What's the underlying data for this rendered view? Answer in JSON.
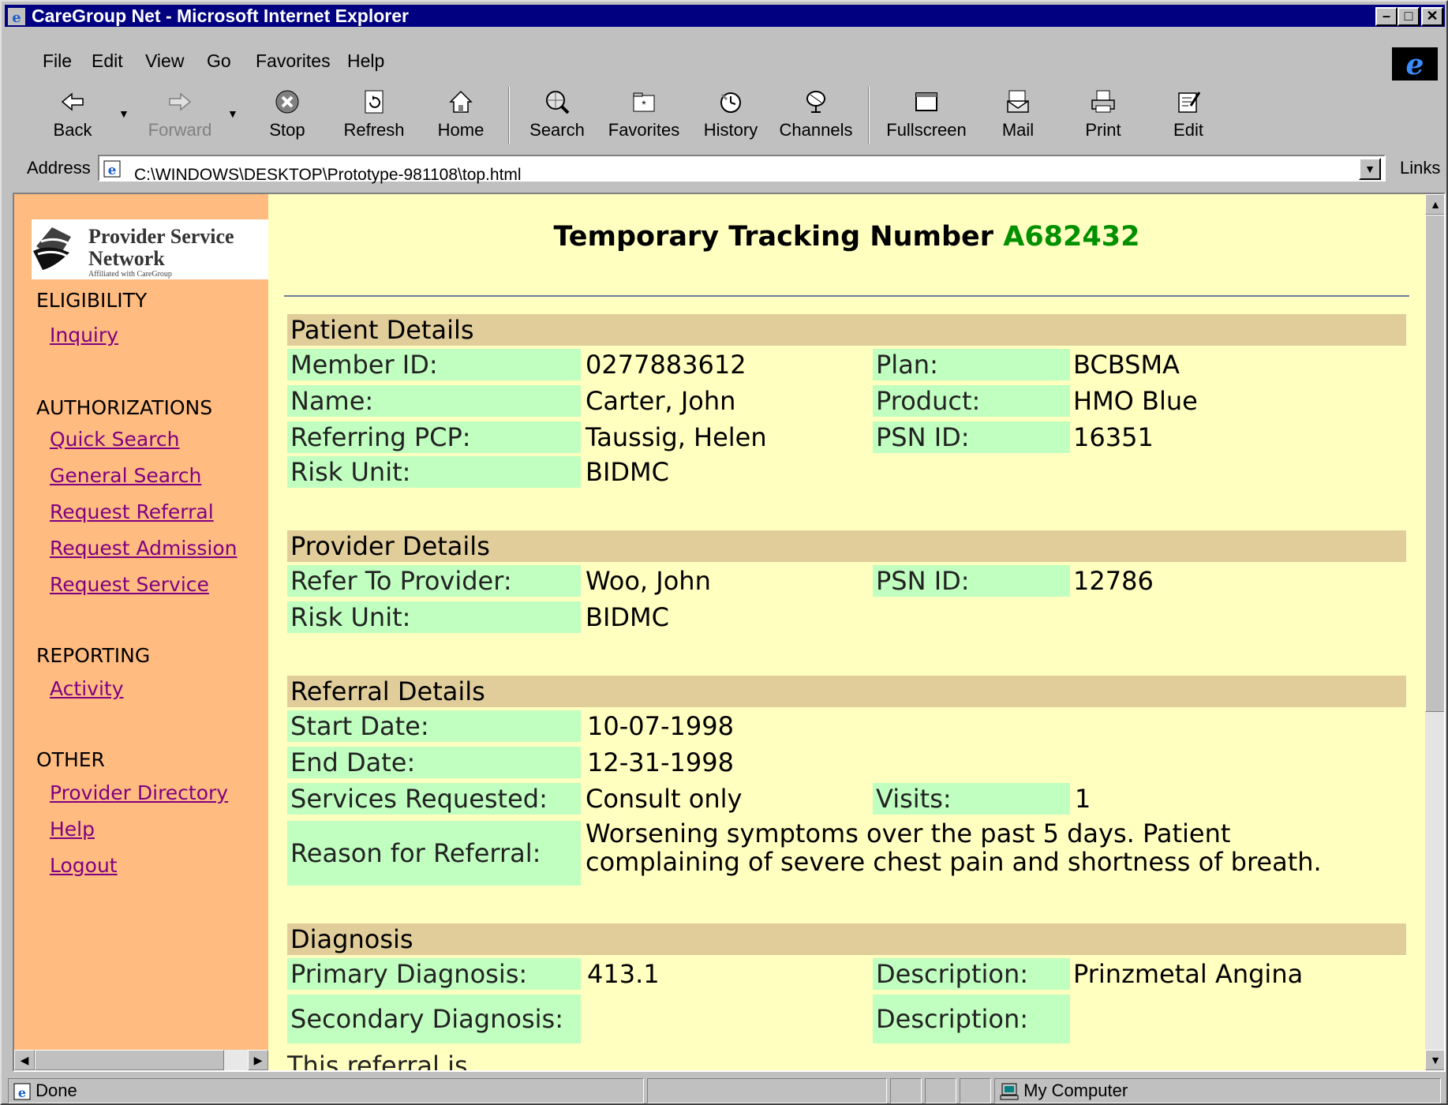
{
  "window": {
    "title": "CareGroup Net - Microsoft Internet Explorer"
  },
  "menu": [
    "File",
    "Edit",
    "View",
    "Go",
    "Favorites",
    "Help"
  ],
  "toolbar": {
    "back": "Back",
    "forward": "Forward",
    "stop": "Stop",
    "refresh": "Refresh",
    "home": "Home",
    "search": "Search",
    "favorites": "Favorites",
    "history": "History",
    "channels": "Channels",
    "fullscreen": "Fullscreen",
    "mail": "Mail",
    "print": "Print",
    "edit": "Edit"
  },
  "address": {
    "label": "Address",
    "value": "C:\\WINDOWS\\DESKTOP\\Prototype-981108\\top.html",
    "links": "Links"
  },
  "logo": {
    "line1": "Provider Service",
    "line2": "Network",
    "tagline": "Affiliated with CareGroup"
  },
  "nav": {
    "eligibility": "ELIGIBILITY",
    "inquiry": "Inquiry",
    "authorizations": "AUTHORIZATIONS",
    "quick_search": "Quick Search",
    "general_search": "General Search",
    "request_referral": "Request Referral",
    "request_admission": "Request Admission",
    "request_service": "Request Service",
    "reporting": "REPORTING",
    "activity": "Activity",
    "other": "OTHER",
    "provider_directory": "Provider Directory",
    "help": "Help",
    "logout": "Logout"
  },
  "tracking": {
    "label": "Temporary Tracking Number",
    "number": "A682432"
  },
  "patient": {
    "header": "Patient Details",
    "member_id_label": "Member ID:",
    "member_id": "0277883612",
    "plan_label": "Plan:",
    "plan": "BCBSMA",
    "name_label": "Name:",
    "name": "Carter, John",
    "product_label": "Product:",
    "product": "HMO Blue",
    "pcp_label": "Referring PCP:",
    "pcp": "Taussig, Helen",
    "psn_label": "PSN ID:",
    "psn": "16351",
    "risk_label": "Risk Unit:",
    "risk": "BIDMC"
  },
  "provider": {
    "header": "Provider Details",
    "refer_label": "Refer To Provider:",
    "refer": "Woo, John",
    "psn_label": "PSN ID:",
    "psn": "12786",
    "risk_label": "Risk Unit:",
    "risk": "BIDMC"
  },
  "referral": {
    "header": "Referral Details",
    "start_label": "Start Date:",
    "start": "10-07-1998",
    "end_label": "End Date:",
    "end": "12-31-1998",
    "services_label": "Services Requested:",
    "services": "Consult only",
    "visits_label": "Visits:",
    "visits": "1",
    "reason_label": "Reason for Referral:",
    "reason_line1": "Worsening symptoms over the past 5 days. Patient",
    "reason_line2": "complaining of severe chest pain and shortness of breath."
  },
  "diagnosis": {
    "header": "Diagnosis",
    "primary_label": "Primary Diagnosis:",
    "primary": "413.1",
    "desc_label": "Description:",
    "desc": "Prinzmetal Angina",
    "secondary_label": "Secondary Diagnosis:",
    "desc2_label": "Description:"
  },
  "footer_text": "This referral is",
  "status": {
    "text": "Done",
    "zone": "My Computer"
  }
}
